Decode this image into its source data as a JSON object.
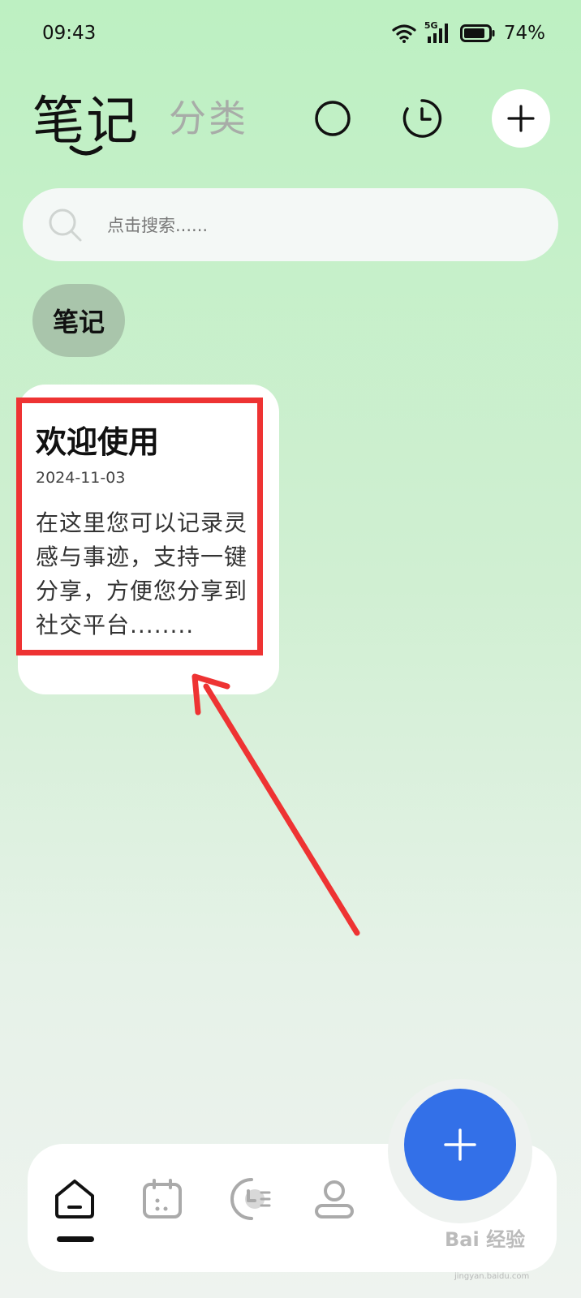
{
  "status_bar": {
    "time": "09:43",
    "network": "5G",
    "battery": "74%"
  },
  "header": {
    "active_tab": "笔记",
    "inactive_tab": "分类",
    "icons": [
      "circle-icon",
      "clock-icon",
      "plus-icon"
    ]
  },
  "search": {
    "placeholder": "点击搜索......"
  },
  "filter_chip": {
    "label": "笔记"
  },
  "note": {
    "title": "欢迎使用",
    "date": "2024-11-03",
    "body": "在这里您可以记录灵感与事迹，支持一键分享，方便您分享到社交平台........"
  },
  "annotation": {
    "box_color": "#ee3333"
  },
  "bottom_nav": {
    "items": [
      "home-icon",
      "calendar-icon",
      "history-icon",
      "profile-icon"
    ],
    "fab_icon": "plus-icon",
    "fab_color": "#3370e8"
  },
  "watermark": {
    "text": "Bai 经验",
    "sub": "jingyan.baidu.com"
  }
}
